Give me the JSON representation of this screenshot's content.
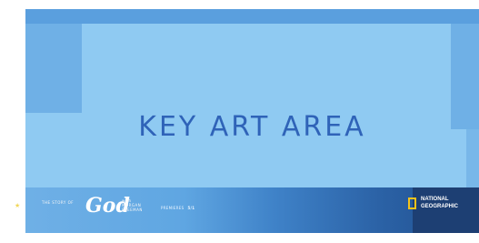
{
  "key_art": {
    "label": "KEY ART AREA"
  },
  "logo": {
    "pre": "THE STORY OF",
    "main": "God",
    "with_line1": "with",
    "with_line2": "MORGAN",
    "with_line3": "FREEMAN"
  },
  "premiere": {
    "text": "PREMIERES",
    "date": "5/1"
  },
  "network": {
    "line1": "NATIONAL",
    "line2": "GEOGRAPHIC"
  },
  "colors": {
    "background": "#8fcaf2",
    "text_blue": "#2f63b8",
    "natgeo_yellow": "#f3c31a",
    "dark_navy": "#1d3f73"
  }
}
